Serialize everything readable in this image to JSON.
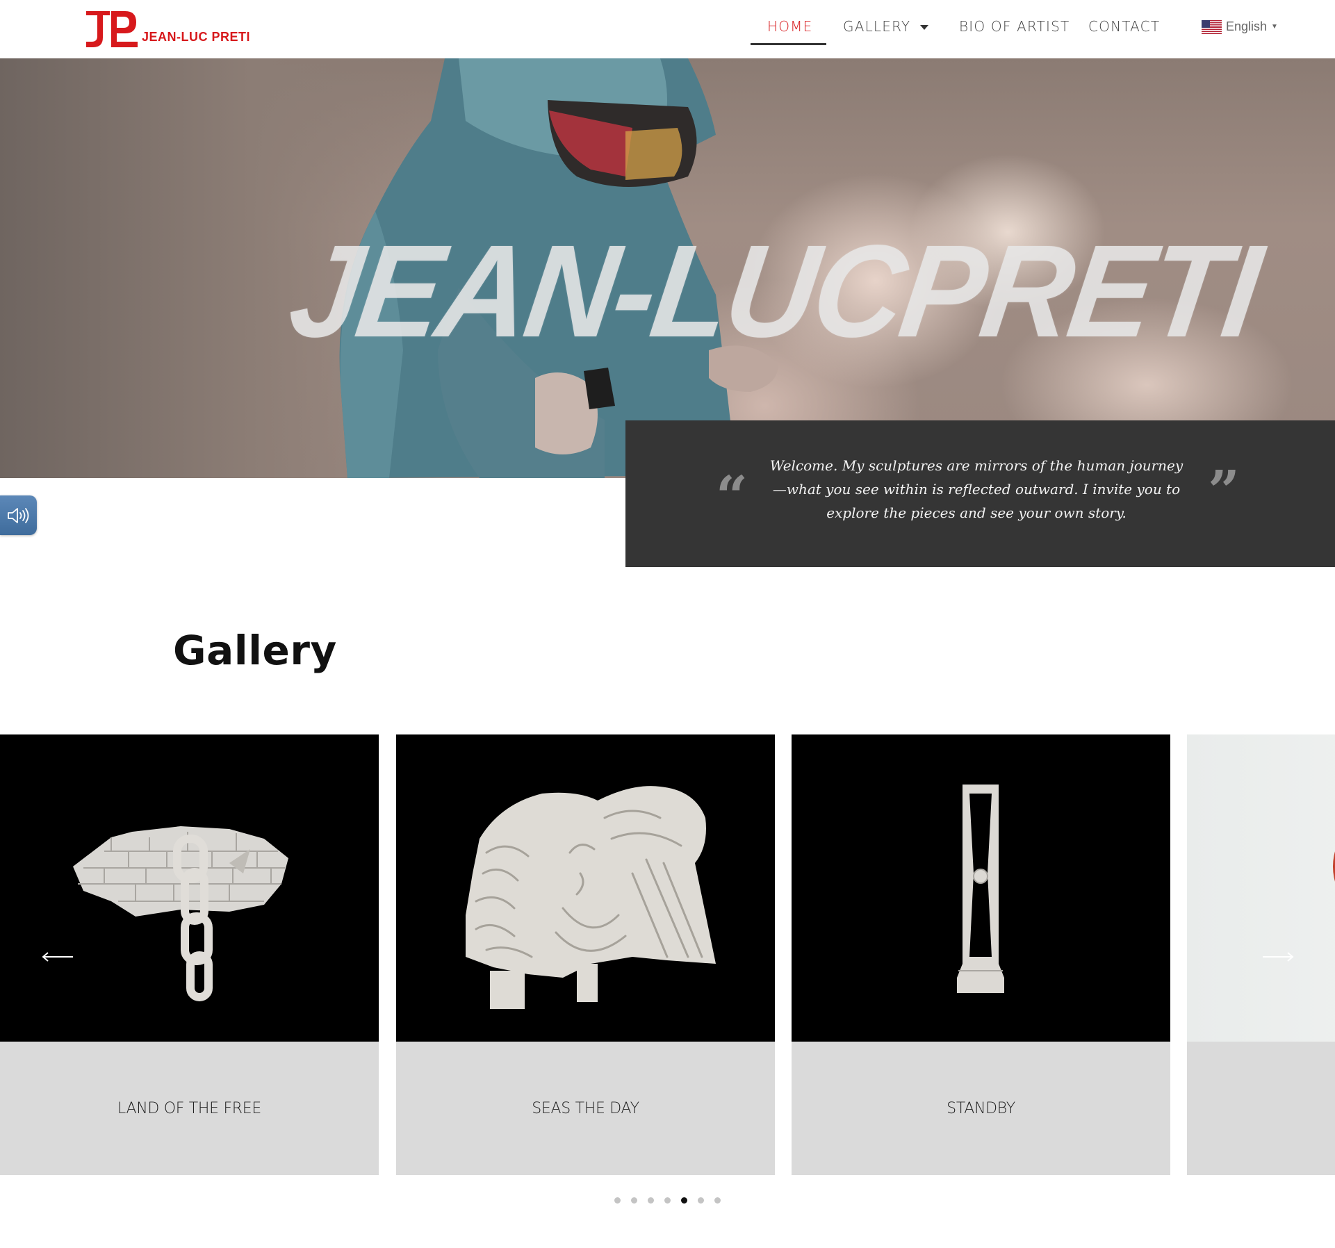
{
  "header": {
    "logo_text": "JEAN-LUC PRETI",
    "nav": [
      {
        "label": "HOME",
        "active": true
      },
      {
        "label": "GALLERY",
        "has_dropdown": true
      },
      {
        "label": "BIO OF ARTIST"
      },
      {
        "label": "CONTACT"
      }
    ],
    "language": {
      "label": "English",
      "flag": "us-flag-icon"
    }
  },
  "hero": {
    "title": "JEAN-LUCPRETI",
    "quote": "Welcome. My sculptures are mirrors of the human journey—what you see within is reflected outward. I invite you to explore the pieces and see your own story.",
    "quote_open": "“",
    "quote_close": "”"
  },
  "gallery": {
    "title": "Gallery",
    "items": [
      {
        "title": "LAND OF THE FREE"
      },
      {
        "title": "SEAS THE DAY"
      },
      {
        "title": "STANDBY"
      },
      {
        "title": ""
      }
    ],
    "prev_arrow": "⟵",
    "next_arrow": "⟶",
    "dots_count": 7,
    "active_dot": 5
  },
  "colors": {
    "brand_red": "#d7191c",
    "quote_bg": "#353535",
    "caption_bg": "#dadada",
    "speaker_blue": "#4a78a8"
  }
}
